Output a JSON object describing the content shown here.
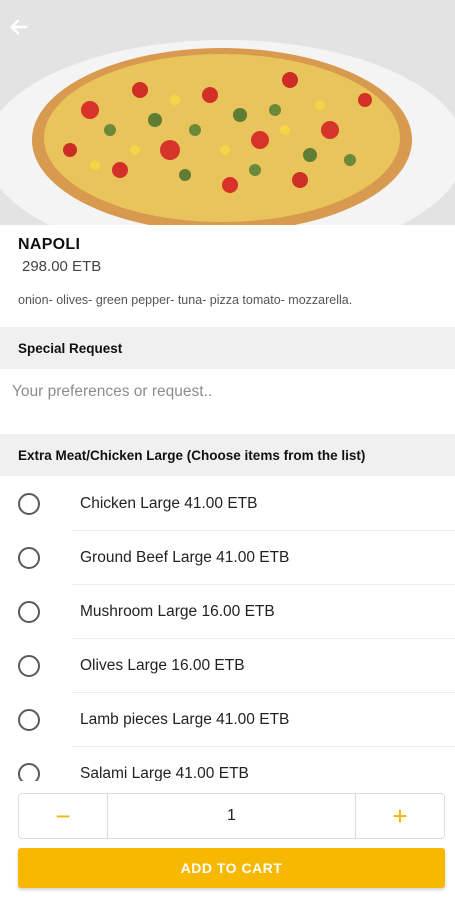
{
  "header": {
    "back_icon": "arrow-left-icon"
  },
  "product": {
    "name": "NAPOLI",
    "price": "298.00 ETB",
    "description": "onion- olives- green pepper- tuna- pizza tomato- mozzarella."
  },
  "special_request": {
    "title": "Special Request",
    "placeholder": "Your preferences or request.."
  },
  "extras": {
    "title": "Extra Meat/Chicken Large (Choose items from the list)",
    "options": [
      {
        "label": "Chicken Large  41.00 ETB",
        "selected": false
      },
      {
        "label": "Ground Beef Large  41.00 ETB",
        "selected": false
      },
      {
        "label": "Mushroom Large  16.00 ETB",
        "selected": false
      },
      {
        "label": "Olives Large  16.00 ETB",
        "selected": false
      },
      {
        "label": "Lamb pieces Large  41.00 ETB",
        "selected": false
      },
      {
        "label": "Salami Large  41.00 ETB",
        "selected": false
      }
    ]
  },
  "quantity": {
    "minus": "−",
    "value": "1",
    "plus": "+"
  },
  "cart": {
    "add_label": "ADD TO CART"
  },
  "colors": {
    "accent": "#f6b800",
    "header_bg": "#f0f0f0"
  }
}
